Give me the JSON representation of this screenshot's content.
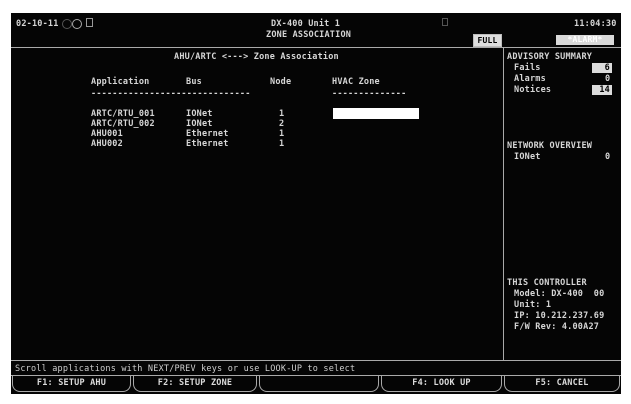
{
  "header": {
    "date": "02-10-11",
    "device_title": "DX-400 Unit 1",
    "screen_title": "ZONE ASSOCIATION",
    "time": "11:04:30",
    "full_label": "FULL",
    "alarm_label": "*ALARM*"
  },
  "main": {
    "panel_title": "AHU/ARTC <---> Zone Association",
    "columns": {
      "application": "Application",
      "bus": "Bus",
      "node": "Node",
      "hvac_zone": "HVAC Zone"
    },
    "separator_app": "------------------------------",
    "separator_zone": "--------------",
    "rows": [
      {
        "application": "ARTC/RTU_001",
        "bus": "IONet",
        "node": "1"
      },
      {
        "application": "ARTC/RTU_002",
        "bus": "IONet",
        "node": "2"
      },
      {
        "application": "AHU001",
        "bus": "Ethernet",
        "node": "1"
      },
      {
        "application": "AHU002",
        "bus": "Ethernet",
        "node": "1"
      }
    ],
    "hvac_zone_value": ""
  },
  "advisory": {
    "title": "ADVISORY SUMMARY",
    "fails_label": "Fails",
    "fails_count": "6",
    "alarms_label": "Alarms",
    "alarms_count": "0",
    "notices_label": "Notices",
    "notices_count": "14"
  },
  "network": {
    "title": "NETWORK OVERVIEW",
    "ionet_label": "IONet",
    "ionet_value": "0"
  },
  "controller": {
    "title": "THIS CONTROLLER",
    "model": "Model: DX-400  00",
    "unit": "Unit: 1",
    "ip": "IP: 10.212.237.69",
    "fw": "F/W Rev: 4.00A27"
  },
  "status_line": "Scroll applications with NEXT/PREV keys or use LOOK-UP to select",
  "function_keys": {
    "f1": "F1: SETUP AHU",
    "f2": "F2: SETUP ZONE",
    "f4": "F4: LOOK UP",
    "f5": "F5: CANCEL"
  },
  "colors": {
    "screen_bg": "#050505",
    "text": "#d6d6d6",
    "highlight": "#dcdcdc"
  }
}
